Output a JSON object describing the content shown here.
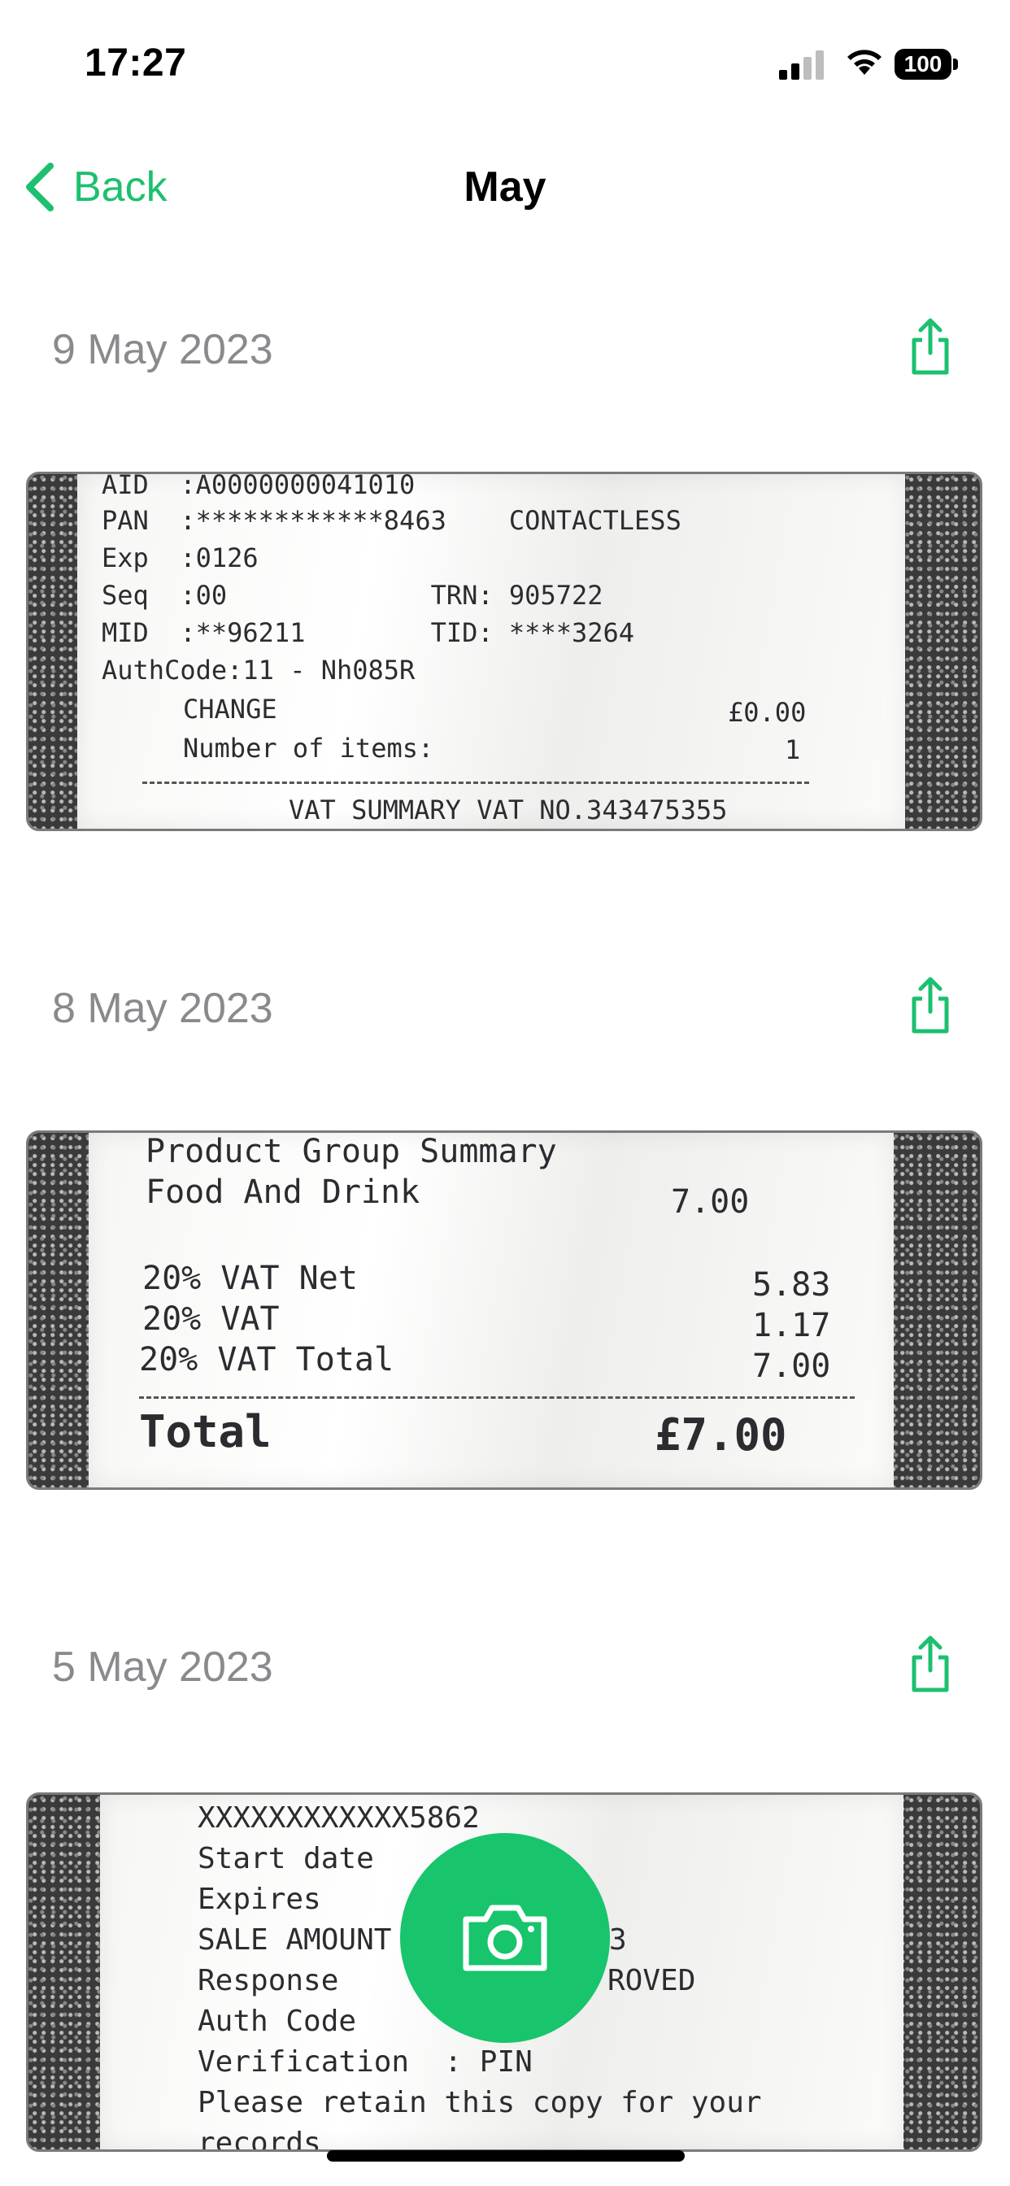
{
  "status_bar": {
    "time": "17:27",
    "battery": "100"
  },
  "nav": {
    "back_label": "Back",
    "title": "May"
  },
  "accent_color": "#1cc06f",
  "sections": [
    {
      "date": "9 May 2023",
      "receipt_lines": [
        "AID  :A0000000041010",
        "PAN  :************8463    CONTACTLESS",
        "Exp  :0126",
        "Seq  :00             TRN: 905722",
        "MID  :**96211        TID: ****3264",
        "AuthCode:11 - Nh085R",
        "CHANGE",
        "£0.00",
        "Number of items:",
        "1",
        "VAT SUMMARY VAT NO.343475355"
      ]
    },
    {
      "date": "8 May 2023",
      "receipt_lines": [
        "Product Group Summary",
        "Food And Drink",
        "7.00",
        "20% VAT Net",
        "5.83",
        "20% VAT",
        "1.17",
        "20% VAT Total",
        "7.00",
        "Total",
        "£7.00"
      ]
    },
    {
      "date": "5 May 2023",
      "receipt_lines": [
        "XXXXXXXXXXXX5862",
        "Start date",
        "Expires",
        "SALE AMOUNT",
        "3",
        "Response",
        "ROVED",
        "Auth Code",
        "Verification  : PIN",
        "Please retain this copy for your",
        "records"
      ]
    }
  ],
  "icons": {
    "back": "chevron-left-icon",
    "share": "share-icon",
    "camera": "camera-icon",
    "signal": "cellular-signal-icon",
    "wifi": "wifi-icon",
    "battery": "battery-icon"
  }
}
